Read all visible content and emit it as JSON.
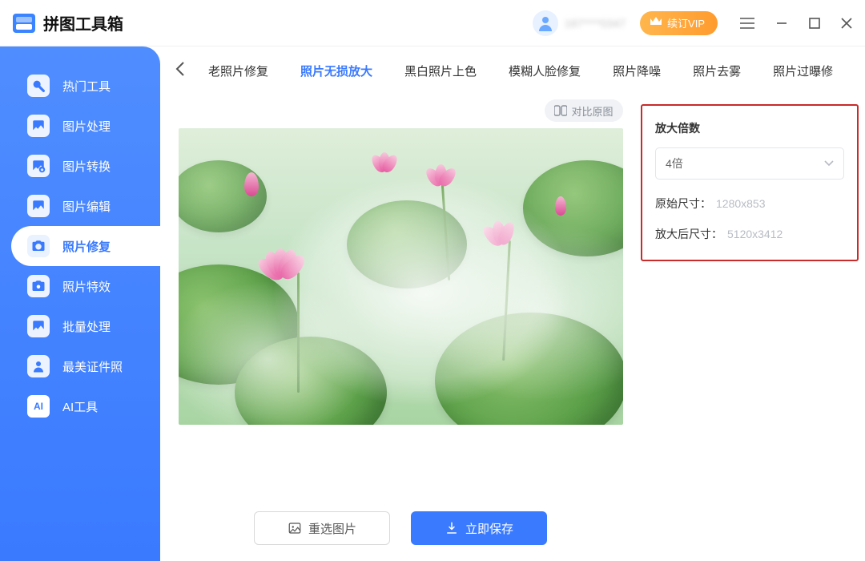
{
  "app": {
    "title": "拼图工具箱",
    "user": "187****0347",
    "vip": "续订VIP"
  },
  "sidebar": {
    "items": [
      {
        "label": "热门工具"
      },
      {
        "label": "图片处理"
      },
      {
        "label": "图片转换"
      },
      {
        "label": "图片编辑"
      },
      {
        "label": "照片修复"
      },
      {
        "label": "照片特效"
      },
      {
        "label": "批量处理"
      },
      {
        "label": "最美证件照"
      },
      {
        "label": "AI工具"
      }
    ]
  },
  "tabs": [
    "老照片修复",
    "照片无损放大",
    "黑白照片上色",
    "模糊人脸修复",
    "照片降噪",
    "照片去雾",
    "照片过曝修"
  ],
  "compare_label": "对比原图",
  "actions": {
    "reselect": "重选图片",
    "save": "立即保存"
  },
  "panel": {
    "title": "放大倍数",
    "select_value": "4倍",
    "orig_label": "原始尺寸：",
    "orig_value": "1280x853",
    "out_label": "放大后尺寸：",
    "out_value": "5120x3412"
  }
}
